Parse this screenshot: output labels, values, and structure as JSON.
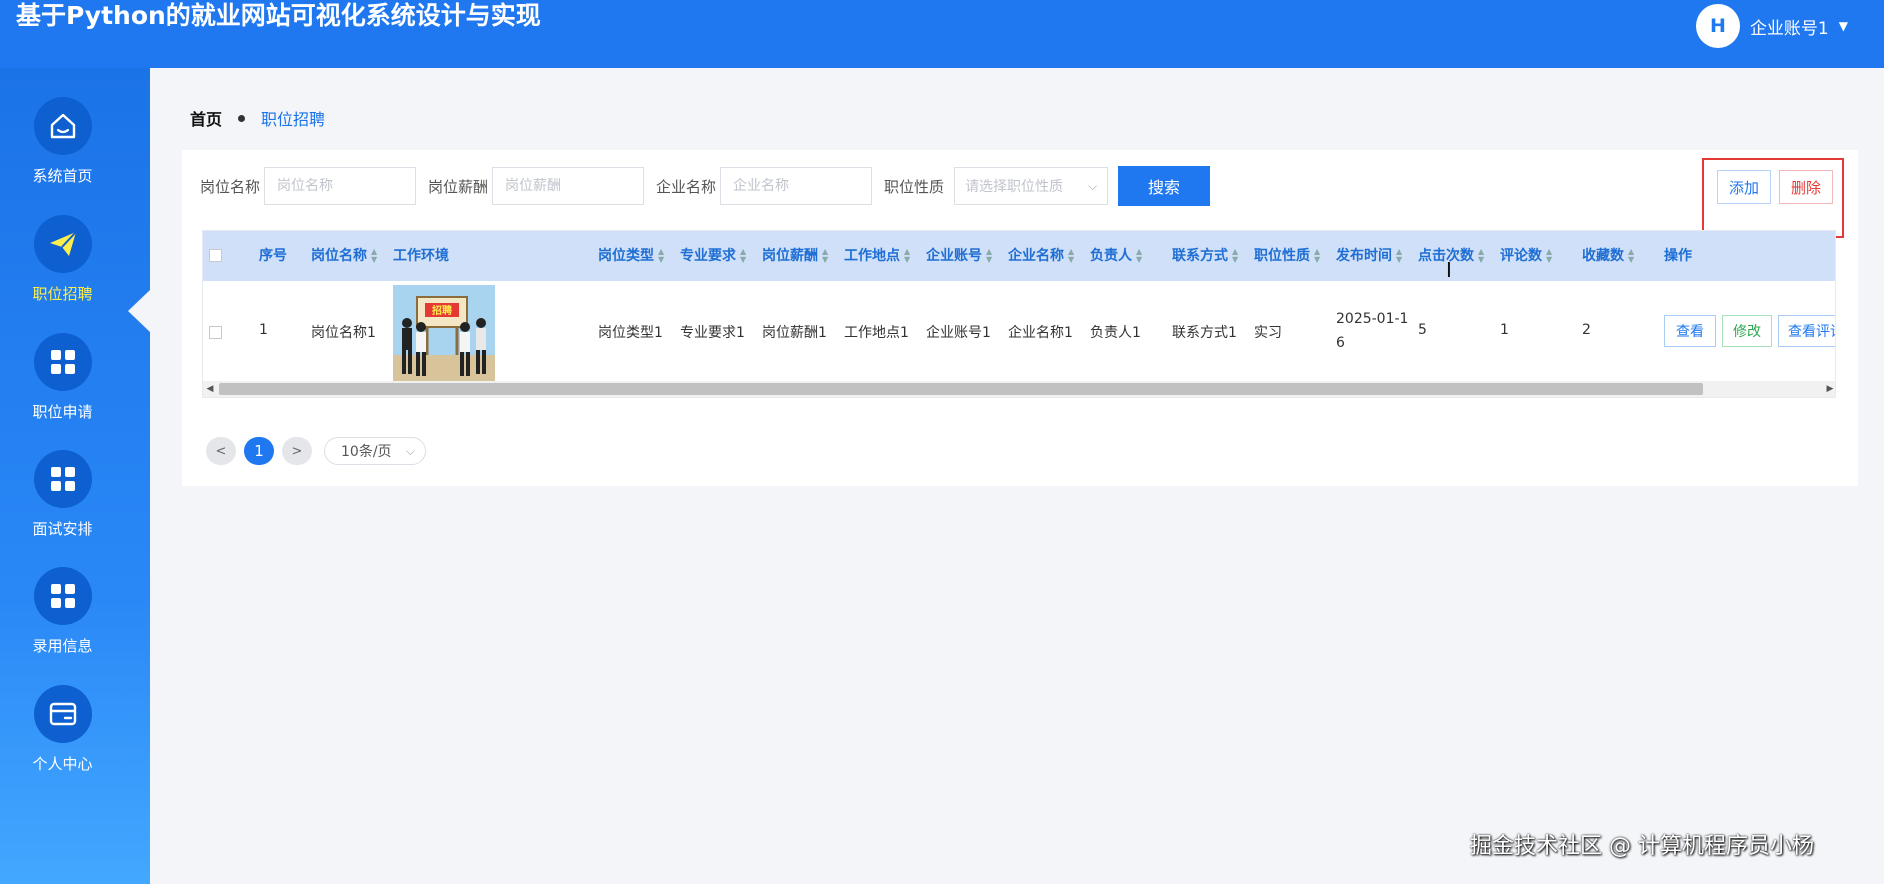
{
  "app": {
    "title": "基于Python的就业网站可视化系统设计与实现",
    "user": {
      "logo": "H",
      "name": "企业账号1"
    },
    "colors": {
      "primary": "#1f78f0",
      "danger": "#e53935",
      "success": "#2fa84f",
      "active_nav": "#ffef4d"
    }
  },
  "sidebar": {
    "items": [
      {
        "label": "系统首页",
        "icon": "home-icon"
      },
      {
        "label": "职位招聘",
        "icon": "paper-plane-icon",
        "active": true
      },
      {
        "label": "职位申请",
        "icon": "grid-icon"
      },
      {
        "label": "面试安排",
        "icon": "grid-icon"
      },
      {
        "label": "录用信息",
        "icon": "grid-icon"
      },
      {
        "label": "个人中心",
        "icon": "card-icon"
      }
    ]
  },
  "breadcrumb": {
    "home": "首页",
    "current": "职位招聘"
  },
  "search": {
    "fields": [
      {
        "label": "岗位名称",
        "placeholder": "岗位名称"
      },
      {
        "label": "岗位薪酬",
        "placeholder": "岗位薪酬"
      },
      {
        "label": "企业名称",
        "placeholder": "企业名称"
      }
    ],
    "select": {
      "label": "职位性质",
      "placeholder": "请选择职位性质"
    },
    "button": "搜索"
  },
  "actions": {
    "add": "添加",
    "delete": "删除"
  },
  "table": {
    "columns": [
      "序号",
      "岗位名称",
      "工作环境",
      "岗位类型",
      "专业要求",
      "岗位薪酬",
      "工作地点",
      "企业账号",
      "企业名称",
      "负责人",
      "联系方式",
      "职位性质",
      "发布时间",
      "点击次数",
      "评论数",
      "收藏数",
      "操作"
    ],
    "rows": [
      {
        "index": "1",
        "job_name": "岗位名称1",
        "image_text": "招聘",
        "job_type": "岗位类型1",
        "major": "专业要求1",
        "salary": "岗位薪酬1",
        "location": "工作地点1",
        "company_account": "企业账号1",
        "company_name": "企业名称1",
        "manager": "负责人1",
        "contact": "联系方式1",
        "job_nature": "实习",
        "publish_time_line1": "2025-01-1",
        "publish_time_line2": "6",
        "clicks": "5",
        "comments": "1",
        "favorites": "2",
        "ops": {
          "view": "查看",
          "edit": "修改",
          "comments": "查看评论"
        }
      }
    ]
  },
  "pagination": {
    "prev": "<",
    "current": "1",
    "next": ">",
    "page_size": "10条/页"
  },
  "watermark": "掘金技术社区 @ 计算机程序员小杨"
}
